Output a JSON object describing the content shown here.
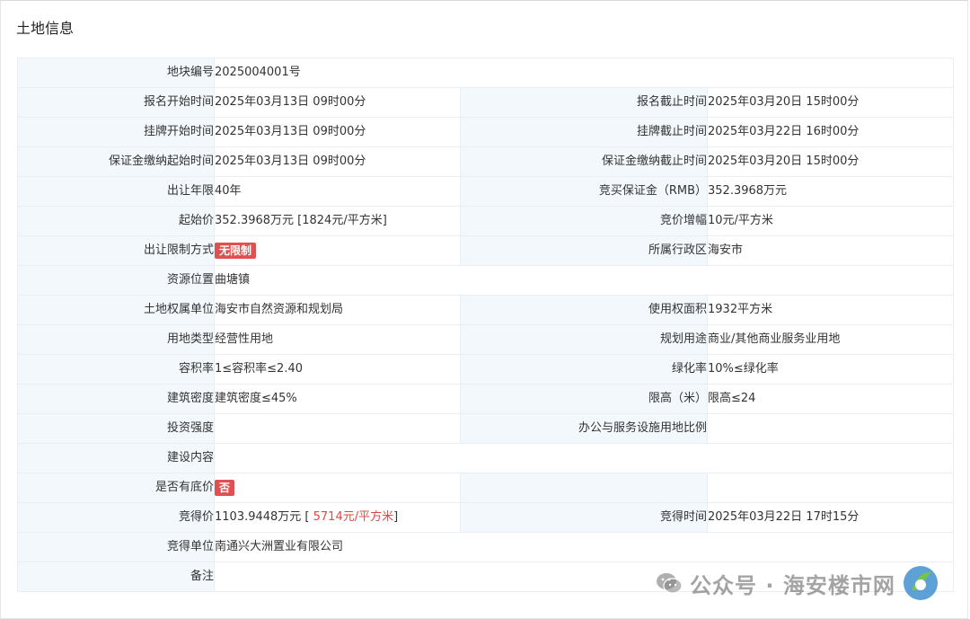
{
  "panel": {
    "title": "土地信息"
  },
  "rows": [
    {
      "l1": "地块编号",
      "v1": "2025004001号"
    },
    {
      "l1": "报名开始时间",
      "v1": "2025年03月13日 09时00分",
      "l2": "报名截止时间",
      "v2": "2025年03月20日 15时00分"
    },
    {
      "l1": "挂牌开始时间",
      "v1": "2025年03月13日 09时00分",
      "l2": "挂牌截止时间",
      "v2": "2025年03月22日 16时00分"
    },
    {
      "l1": "保证金缴纳起始时间",
      "v1": "2025年03月13日 09时00分",
      "l2": "保证金缴纳截止时间",
      "v2": "2025年03月20日 15时00分"
    },
    {
      "l1": "出让年限",
      "v1": "40年",
      "l2": "竞买保证金（RMB）",
      "v2": "352.3968万元"
    },
    {
      "l1": "起始价",
      "v1": "352.3968万元 [1824元/平方米]",
      "l2": "竞价增幅",
      "v2": "10元/平方米"
    },
    {
      "l1": "出让限制方式",
      "badge1": "无限制",
      "l2": "所属行政区",
      "v2": "海安市"
    },
    {
      "l1": "资源位置",
      "v1": "曲塘镇"
    },
    {
      "l1": "土地权属单位",
      "v1": "海安市自然资源和规划局",
      "l2": "使用权面积",
      "v2": "1932平方米"
    },
    {
      "l1": "用地类型",
      "v1": "经营性用地",
      "l2": "规划用途",
      "v2": "商业/其他商业服务业用地"
    },
    {
      "l1": "容积率",
      "v1": "1≤容积率≤2.40",
      "l2": "绿化率",
      "v2": "10%≤绿化率"
    },
    {
      "l1": "建筑密度",
      "v1": "建筑密度≤45%",
      "l2": "限高（米）",
      "v2": "限高≤24"
    },
    {
      "l1": "投资强度",
      "v1": "",
      "l2": "办公与服务设施用地比例",
      "v2": ""
    },
    {
      "l1": "建设内容",
      "v1": ""
    },
    {
      "l1": "是否有底价",
      "badge1": "否",
      "l2": "",
      "v2": ""
    },
    {
      "l1": "竞得价",
      "v1_prefix": "1103.9448万元 [ ",
      "v1_red": "5714元/平方米",
      "v1_suffix": "]",
      "l2": "竞得时间",
      "v2": "2025年03月22日 17时15分"
    },
    {
      "l1": "竞得单位",
      "v1": "南通兴大洲置业有限公司"
    },
    {
      "l1": "备注",
      "v1": ""
    }
  ],
  "watermark": {
    "text": "公众号 · 海安楼市网"
  },
  "colors": {
    "label_bg": "#f2f8fc",
    "border": "#e8eef3",
    "badge": "#e05050",
    "highlight": "#e04848"
  }
}
